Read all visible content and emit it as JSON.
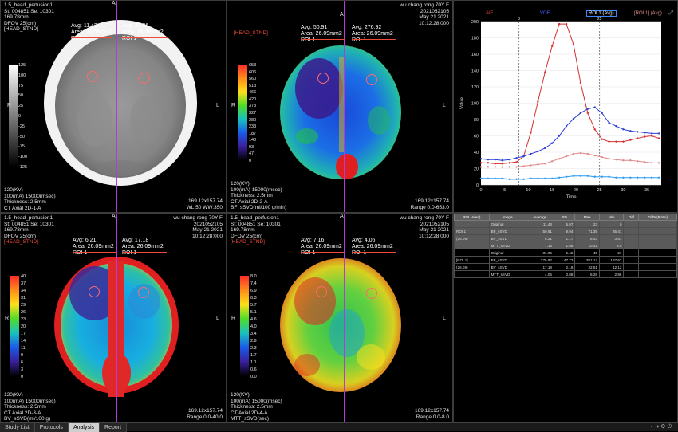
{
  "viewports": [
    {
      "id": "vp1",
      "tl": [
        "1.5_head_perfusion1",
        "St: 004851 Se: 10301",
        "169.78mm",
        "DFOV 25(cm)",
        "[HEAD_STND]"
      ],
      "tr": [],
      "bl": [
        "120(KV)",
        "100(mA) 15000(msec)",
        "Thickness: 2.5mm",
        "CT Axial 2D-1-A"
      ],
      "br": [
        "169.12x157.74",
        "WL:50 WW:350"
      ],
      "roi_left": {
        "avg": "Avg: 11.43",
        "area": "Area: 26.09mm2",
        "label": "ROI 1"
      },
      "roi_right": {
        "avg": "Avg: 31.96",
        "area": "Area: 26.09mm2",
        "label": "ROI 1"
      },
      "scale": [
        "125",
        "100",
        "75",
        "50",
        "25",
        "0",
        "-25",
        "-50",
        "-75",
        "-100",
        "-125"
      ],
      "orient": {
        "a": "A",
        "r": "R",
        "l": "L"
      }
    },
    {
      "id": "vp2",
      "tl": [
        "[HEAD_STND]"
      ],
      "tr": [
        "wu chang rong 70Y F",
        "2021052105",
        "May 21 2021",
        "10:12:28:000"
      ],
      "bl": [
        "120(KV)",
        "100(mA) 15000(msec)",
        "Thickness: 2.5mm",
        "CT Axial 2D-2-A",
        "BF_sSVD(ml/100 g/min)"
      ],
      "br": [
        "169.12x157.74",
        "Range 0.0-653.0"
      ],
      "roi_left": {
        "avg": "Avg: 50.91",
        "area": "Area: 26.09mm2",
        "label": "ROI 1"
      },
      "roi_right": {
        "avg": "Avg: 276.92",
        "area": "Area: 26.09mm2",
        "label": "ROI 1"
      },
      "scale": [
        "653",
        "606",
        "560",
        "513",
        "466",
        "420",
        "373",
        "327",
        "280",
        "233",
        "187",
        "140",
        "93",
        "47",
        "0"
      ],
      "orient": {
        "a": "A",
        "r": "R",
        "l": "L"
      }
    },
    {
      "id": "vp3",
      "tl": [
        "1.5_head_perfusion1",
        "St: 004851 Se: 10301",
        "169.78mm",
        "DFOV 25(cm)",
        "[HEAD_STND]"
      ],
      "tr": [
        "wu chang rong 70Y F",
        "2021052105",
        "May 21 2021",
        "10:12:28:000"
      ],
      "bl": [
        "120(KV)",
        "100(mA) 15000(msec)",
        "Thickness: 2.5mm",
        "CT Axial 2D-3-A",
        "BV_sSVD(ml/100 g)"
      ],
      "br": [
        "169.12x157.74",
        "Range 0.0-40.0"
      ],
      "roi_left": {
        "avg": "Avg: 6.21",
        "area": "Area: 26.09mm2",
        "label": "ROI 1"
      },
      "roi_right": {
        "avg": "Avg: 17.18",
        "area": "Area: 26.09mm2",
        "label": "ROI 1"
      },
      "scale": [
        "40",
        "37",
        "34",
        "31",
        "29",
        "26",
        "23",
        "20",
        "17",
        "14",
        "11",
        "9",
        "6",
        "3",
        "0"
      ],
      "orient": {
        "a": "A",
        "r": "R",
        "l": "L"
      }
    },
    {
      "id": "vp4",
      "tl": [
        "1.5_head_perfusion1",
        "St: 004851 Se: 10301",
        "169.78mm",
        "DFOV 25(cm)",
        "[HEAD_STND]"
      ],
      "tr": [
        "wu chang rong 70Y F",
        "2021052105",
        "May 21 2021",
        "10:12:28:000"
      ],
      "bl": [
        "120(KV)",
        "100(mA) 15000(msec)",
        "Thickness: 2.5mm",
        "CT Axial 2D-4-A",
        "MTT_sSVD(sec)"
      ],
      "br": [
        "169.12x157.74",
        "Range 0.0-8.0"
      ],
      "roi_left": {
        "avg": "Avg: 7.16",
        "area": "Area: 26.09mm2",
        "label": "ROI 1"
      },
      "roi_right": {
        "avg": "Avg: 4.06",
        "area": "Area: 26.09mm2",
        "label": "ROI 1"
      },
      "scale": [
        "8.0",
        "7.4",
        "6.9",
        "6.3",
        "5.7",
        "5.1",
        "4.6",
        "4.0",
        "3.4",
        "2.9",
        "2.3",
        "1.7",
        "1.1",
        "0.6",
        "0.0"
      ],
      "orient": {
        "a": "A",
        "r": "R",
        "l": "L"
      }
    }
  ],
  "chart_data": {
    "type": "line",
    "legend": [
      "AIF",
      "VOF",
      "ROI 1 (Avg)",
      "[ROI 1] (Avg)"
    ],
    "xlabel": "Time",
    "ylabel": "Value",
    "xlim": [
      0,
      38
    ],
    "ylim": [
      0,
      200
    ],
    "x_ticks": [
      "0",
      "5",
      "10",
      "15",
      "20",
      "25",
      "30",
      "35"
    ],
    "y_ticks": [
      "0",
      "20",
      "40",
      "60",
      "80",
      "100",
      "120",
      "140",
      "160",
      "180",
      "200"
    ],
    "markers": [
      "8",
      "25"
    ],
    "series": [
      {
        "name": "AIF",
        "color": "#d42f2f",
        "x": [
          0,
          1.5,
          3,
          4.5,
          6,
          7.5,
          9,
          10.5,
          12,
          13.5,
          15,
          16.5,
          18,
          19.5,
          21,
          22.5,
          24,
          25.5,
          27,
          28.5,
          30,
          31.5,
          33,
          34.5,
          36,
          37.5
        ],
        "y": [
          27,
          27,
          26,
          26,
          27,
          28,
          35,
          64,
          102,
          138,
          170,
          197,
          197,
          172,
          125,
          88,
          68,
          56,
          53,
          53,
          53,
          55,
          57,
          59,
          60,
          57
        ]
      },
      {
        "name": "VOF",
        "color": "#2a3fd8",
        "x": [
          0,
          1.5,
          3,
          4.5,
          6,
          7.5,
          9,
          10.5,
          12,
          13.5,
          15,
          16.5,
          18,
          19.5,
          21,
          22.5,
          24,
          25.5,
          27,
          28.5,
          30,
          31.5,
          33,
          34.5,
          36,
          37.5
        ],
        "y": [
          32,
          31,
          31,
          30,
          31,
          33,
          35,
          38,
          41,
          45,
          51,
          60,
          72,
          81,
          88,
          93,
          95,
          88,
          76,
          72,
          68,
          66,
          65,
          64,
          63,
          63
        ]
      },
      {
        "name": "ROI 1 (Avg)",
        "color": "#e08a8a",
        "x": [
          0,
          1.5,
          3,
          4.5,
          6,
          7.5,
          9,
          10.5,
          12,
          13.5,
          15,
          16.5,
          18,
          19.5,
          21,
          22.5,
          24,
          25.5,
          27,
          28.5,
          30,
          31.5,
          33,
          34.5,
          36,
          37.5
        ],
        "y": [
          22,
          22,
          22,
          22,
          22,
          22,
          23,
          24,
          25,
          26,
          29,
          32,
          35,
          38,
          39,
          38,
          36,
          34,
          32,
          31,
          30,
          30,
          29,
          28,
          27,
          27
        ]
      },
      {
        "name": "[ROI 1] (Avg)",
        "color": "#2c9cf0",
        "x": [
          0,
          1.5,
          3,
          4.5,
          6,
          7.5,
          9,
          10.5,
          12,
          13.5,
          15,
          16.5,
          18,
          19.5,
          21,
          22.5,
          24,
          25.5,
          27,
          28.5,
          30,
          31.5,
          33,
          34.5,
          36,
          37.5
        ],
        "y": [
          8,
          8,
          8,
          8,
          7,
          7,
          7,
          8,
          8,
          8,
          8,
          9,
          10,
          11,
          11,
          11,
          10,
          10,
          10,
          9,
          9,
          9,
          9,
          9,
          9,
          9
        ]
      }
    ]
  },
  "chart_header": {
    "aif": "AIF",
    "vof": "VOF",
    "roi": "ROI 1 (Avg)",
    "roi2": "[ROI 1] (Avg)"
  },
  "table": {
    "columns": [
      "ROI (Area)",
      "Image",
      "Average",
      "SD",
      "Max",
      "Min",
      "Diff",
      "Diff%(Ratio)"
    ],
    "rows": [
      {
        "roi": "",
        "image": "Original",
        "avg": "11.43",
        "sd": "5.97",
        "max": "23",
        "min": "0",
        "diff": "",
        "ratio": ""
      },
      {
        "roi": "ROI 1",
        "image": "BF_sSVD",
        "avg": "50.91",
        "sd": "9.94",
        "max": "71.39",
        "min": "35.41",
        "diff": "",
        "ratio": ""
      },
      {
        "roi": "(26.09)",
        "image": "BV_sSVD",
        "avg": "6.21",
        "sd": "1.17",
        "max": "8.43",
        "min": "3.81",
        "diff": "",
        "ratio": ""
      },
      {
        "roi": "",
        "image": "MTT_sSVD",
        "avg": "7.16",
        "sd": "1.58",
        "max": "10.31",
        "min": "3.5",
        "diff": "",
        "ratio": ""
      },
      {
        "roi": "",
        "image": "Original",
        "avg": "31.96",
        "sd": "5.42",
        "max": "45",
        "min": "21",
        "diff": "",
        "ratio": ""
      },
      {
        "roi": "[ROI 1]",
        "image": "BF_sSVD",
        "avg": "276.92",
        "sd": "47.72",
        "max": "381.14",
        "min": "187.67",
        "diff": "",
        "ratio": ""
      },
      {
        "roi": "(26.09)",
        "image": "BV_sSVD",
        "avg": "17.18",
        "sd": "2.18",
        "max": "22.51",
        "min": "12.12",
        "diff": "",
        "ratio": ""
      },
      {
        "roi": "",
        "image": "MTT_sSVD",
        "avg": "4.06",
        "sd": "0.88",
        "max": "6.28",
        "min": "2.86",
        "diff": "",
        "ratio": ""
      }
    ]
  },
  "taskbar": {
    "tabs": [
      "Study List",
      "Protocols",
      "Analysis",
      "Report"
    ],
    "active": "Analysis"
  }
}
